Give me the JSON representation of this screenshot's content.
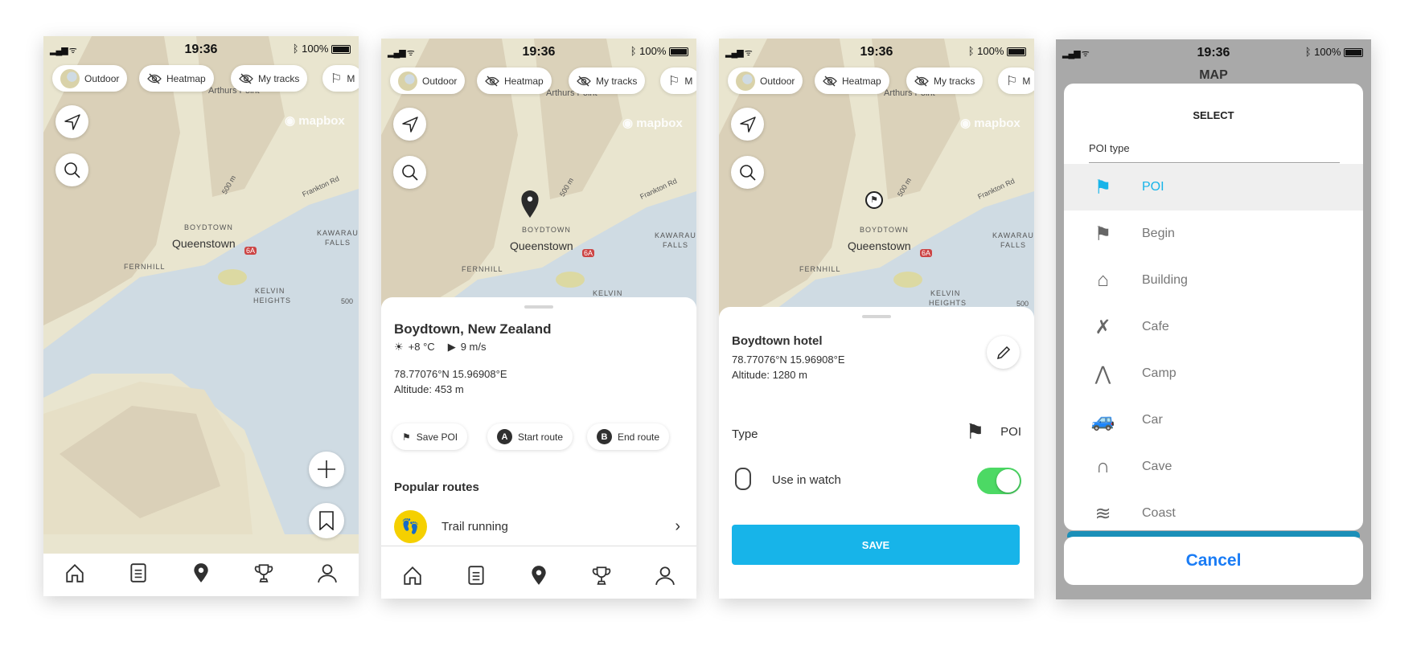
{
  "status": {
    "time": "19:36",
    "battery": "100%",
    "bluetooth": "bluetooth-icon",
    "signal": "signal-icon",
    "wifi": "wifi-icon"
  },
  "chips": [
    {
      "label": "Outdoor",
      "icon": "map-style-globe-icon"
    },
    {
      "label": "Heatmap",
      "icon": "eye-off-icon"
    },
    {
      "label": "My tracks",
      "icon": "eye-off-icon"
    },
    {
      "label": "M",
      "icon": "flag-icon"
    }
  ],
  "map": {
    "attribution": "mapbox",
    "labels": {
      "arthurs": "Arthurs Point",
      "boydtown": "BOYDTOWN",
      "queenstown": "Queenstown",
      "fernhill": "FERNHILL",
      "kawarau": "KAWARAU",
      "falls": "FALLS",
      "kelvin": "KELVIN",
      "heights": "HEIGHTS",
      "frankton": "Frankton Rd",
      "contour": "500 m",
      "contour2": "500",
      "highway": "6A"
    },
    "colors": {
      "land": "#e9e5cf",
      "water": "#cfdbe3",
      "hills": "#cdbfa6"
    }
  },
  "nav": [
    {
      "name": "home-icon"
    },
    {
      "name": "diary-icon"
    },
    {
      "name": "map-pin-icon",
      "active": true
    },
    {
      "name": "trophy-icon"
    },
    {
      "name": "profile-icon"
    }
  ],
  "screen2": {
    "place": "Boydtown, New Zealand",
    "temp": "+8 °C",
    "wind": "9 m/s",
    "coords": "78.77076°N 15.96908°E",
    "altitude": "Altitude: 453 m",
    "actions": {
      "save_poi": "Save POI",
      "start_route": "Start route",
      "start_badge": "A",
      "end_route": "End route",
      "end_badge": "B"
    },
    "popular_title": "Popular routes",
    "routes": [
      {
        "label": "Trail running",
        "color": "#f5d000"
      }
    ]
  },
  "screen3": {
    "name": "Boydtown hotel",
    "coords": "78.77076°N 15.96908°E",
    "altitude": "Altitude: 1280 m",
    "type_label": "Type",
    "type_value": "POI",
    "watch_label": "Use in watch",
    "watch_enabled": true,
    "save": "SAVE",
    "accent": "#17b4e9",
    "toggle_color": "#4cd964"
  },
  "screen4": {
    "header": "MAP",
    "title": "SELECT",
    "field_label": "POI type",
    "selected": "POI",
    "options": [
      "POI",
      "Begin",
      "Building",
      "Cafe",
      "Camp",
      "Car",
      "Cave",
      "Coast"
    ],
    "cancel": "Cancel",
    "selected_color": "#17b4e9",
    "cancel_color": "#1a7cf5"
  }
}
